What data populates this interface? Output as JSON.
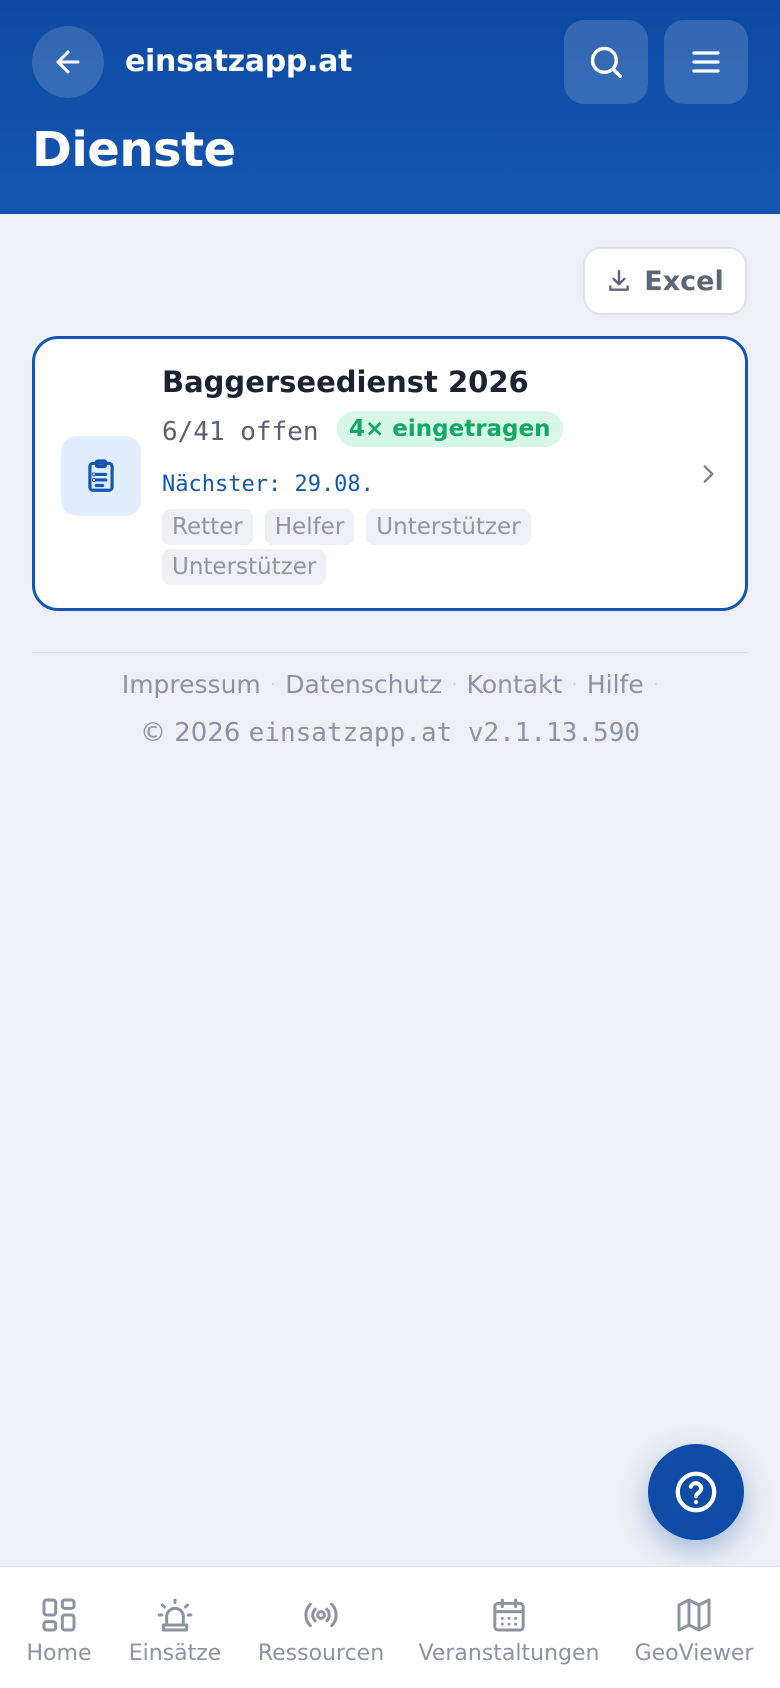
{
  "header": {
    "brand": "einsatzapp.at",
    "title": "Dienste",
    "icons": [
      "arrow-left-icon",
      "search-icon",
      "menu-icon"
    ]
  },
  "toolbar": {
    "excel_label": "Excel",
    "excel_icon": "download-icon"
  },
  "services": [
    {
      "title": "Baggerseedienst 2026",
      "open": "6/41 offen",
      "registered_badge": "4× eingetragen",
      "next": "Nächster: 29.08.",
      "tags": [
        "Retter",
        "Helfer",
        "Unterstützer",
        "Unterstützer"
      ],
      "icon": "clipboard-icon"
    }
  ],
  "footer": {
    "links": [
      "Impressum",
      "Datenschutz",
      "Kontakt",
      "Hilfe"
    ],
    "copyright": "© 2026",
    "version": "einsatzapp.at v2.1.13.590"
  },
  "nav": [
    {
      "label": "Home",
      "icon": "grid-icon"
    },
    {
      "label": "Einsätze",
      "icon": "siren-icon"
    },
    {
      "label": "Ressourcen",
      "icon": "radio-icon"
    },
    {
      "label": "Veranstaltungen",
      "icon": "calendar-icon"
    },
    {
      "label": "GeoViewer",
      "icon": "map-icon"
    }
  ],
  "colors": {
    "primary": "#1356b0",
    "header_dark": "#0d4aa3",
    "success": "#11a863",
    "background": "#eef0f6"
  }
}
